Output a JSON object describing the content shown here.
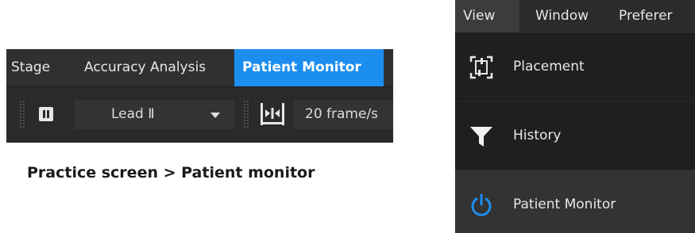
{
  "practice_panel": {
    "tabs": [
      {
        "label": "Stage"
      },
      {
        "label": "Accuracy Analysis"
      },
      {
        "label": "Patient Monitor",
        "active": true
      }
    ],
    "toolbar": {
      "lead_select_value": "Lead Ⅱ",
      "frame_rate_value": "20 frame/s"
    }
  },
  "caption": "Practice screen > Patient monitor",
  "view_menu": {
    "menubar": [
      {
        "label": "View",
        "active": true
      },
      {
        "label": "Window"
      },
      {
        "label": "Preferer"
      }
    ],
    "items": [
      {
        "label": "Placement",
        "icon": "placement-icon"
      },
      {
        "label": "History",
        "icon": "filter-icon"
      },
      {
        "label": "Patient Monitor",
        "icon": "power-icon",
        "hovered": true
      }
    ]
  },
  "colors": {
    "accent": "#1c8ef0",
    "panel_bg": "#2b2b2b",
    "menu_bg": "#1f1f1f",
    "text": "#e8e8e8"
  }
}
